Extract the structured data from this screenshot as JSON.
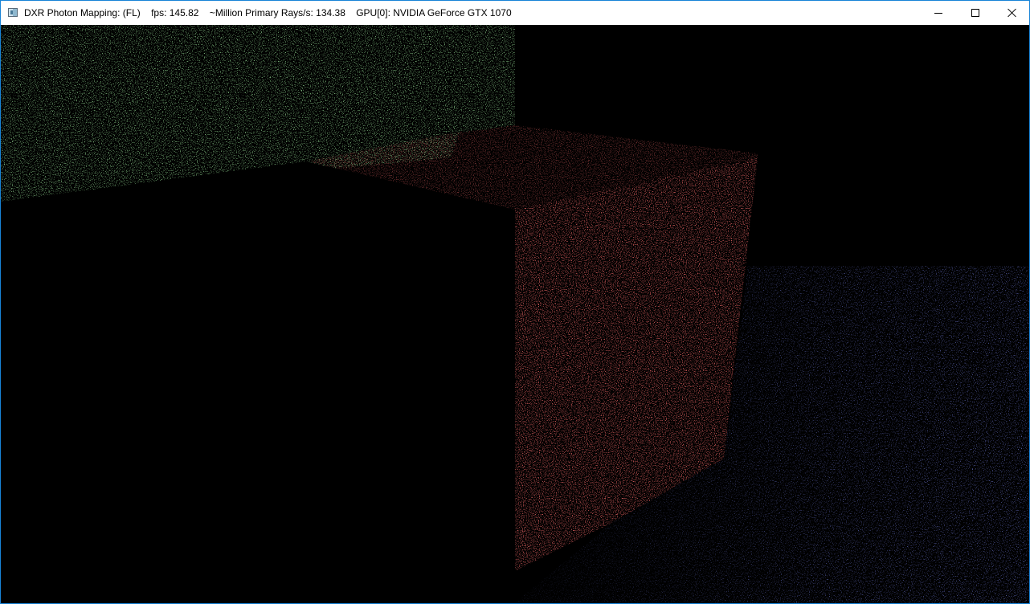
{
  "window": {
    "title_app": "DXR Photon Mapping: (FL)",
    "fps_text": "fps: 145.82",
    "rays_text": "~Million Primary Rays/s: 134.38",
    "gpu_text": "GPU[0]: NVIDIA GeForce GTX 1070",
    "icons": {
      "app": "app-window-icon",
      "minimize": "minimize-icon",
      "maximize": "maximize-icon",
      "close": "close-icon"
    }
  },
  "scene": {
    "colors": {
      "background": "#000000",
      "green_wall_noise": "#2f6a2f",
      "red_box_noise": "#7a1616",
      "blue_floor_noise": "#1a1f6a"
    }
  }
}
